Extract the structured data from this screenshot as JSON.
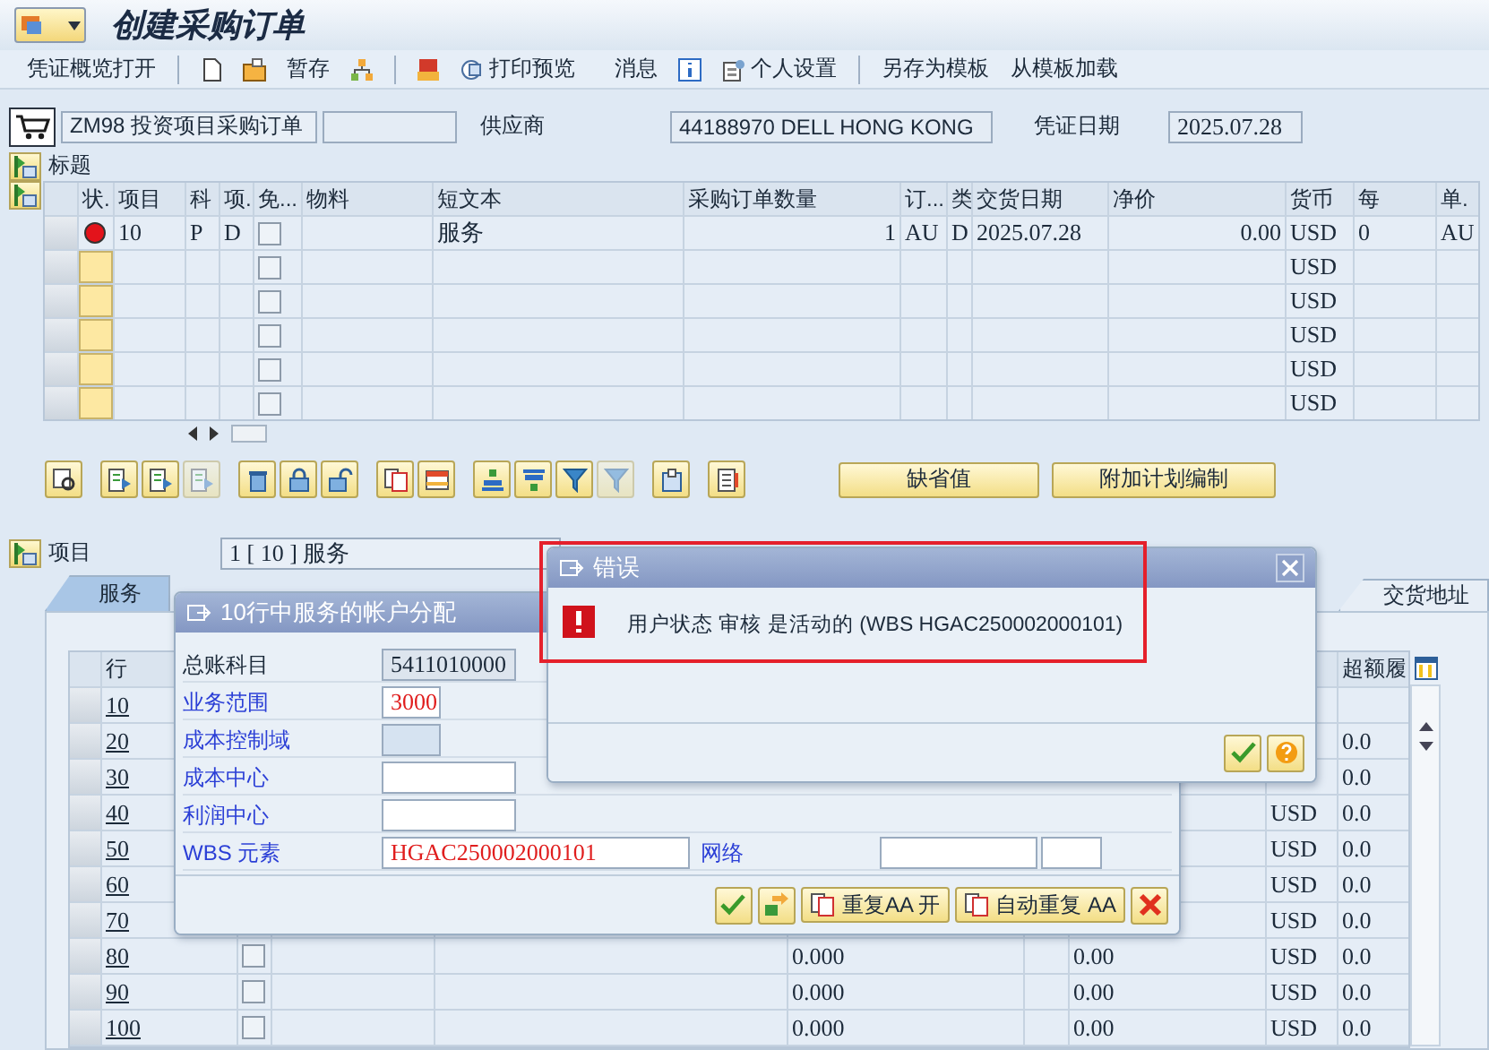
{
  "window": {
    "title": "创建采购订单"
  },
  "toolbar": {
    "overview": "凭证概览打开",
    "hold": "暂存",
    "print_preview": "打印预览",
    "messages": "消息",
    "personal_settings": "个人设置",
    "save_template": "另存为模板",
    "load_template": "从模板加载"
  },
  "header": {
    "doc_type": "ZM98 投资项目采购订单",
    "vendor_label": "供应商",
    "vendor": "44188970 DELL HONG KONG",
    "doc_date_label": "凭证日期",
    "doc_date": "2025.07.28"
  },
  "header_section": {
    "label": "标题"
  },
  "items_table": {
    "columns": [
      "状.",
      "项目",
      "科",
      "项.",
      "免...",
      "物料",
      "短文本",
      "采购订单数量",
      "订...",
      "类",
      "交货日期",
      "净价",
      "货币",
      "每",
      "单."
    ],
    "rows": [
      {
        "error": true,
        "item": "10",
        "acct": "P",
        "cat": "D",
        "free": false,
        "short_text": "服务",
        "qty": "1",
        "unit": "AU",
        "date_cat": "D",
        "delivery_date": "2025.07.28",
        "net_price": "0.00",
        "currency": "USD",
        "per": "0",
        "order_unit": "AU"
      },
      {
        "error": false,
        "free": false,
        "currency": "USD"
      },
      {
        "error": false,
        "free": false,
        "currency": "USD"
      },
      {
        "error": false,
        "free": false,
        "currency": "USD"
      },
      {
        "error": false,
        "free": false,
        "currency": "USD"
      },
      {
        "error": false,
        "free": false,
        "currency": "USD"
      }
    ]
  },
  "table_tools": [
    {
      "disabled": false
    },
    {
      "disabled": false
    },
    {
      "disabled": false
    },
    {
      "disabled": true
    },
    {
      "disabled": false
    },
    {
      "disabled": false
    },
    {
      "disabled": false
    },
    {
      "disabled": false
    },
    {
      "disabled": false
    },
    {
      "disabled": false
    },
    {
      "disabled": false
    },
    {
      "disabled": false
    },
    {
      "disabled": true
    },
    {
      "disabled": false
    },
    {
      "disabled": false
    }
  ],
  "table_buttons": [
    "缺省值",
    "附加计划编制"
  ],
  "item_section": {
    "label": "项目",
    "value": "1 [ 10 ] 服务"
  },
  "tabs": [
    {
      "label": "服务",
      "selected": true
    },
    {
      "label": "交货地址",
      "selected": false
    }
  ],
  "service_table": {
    "columns": [
      "行",
      "超额履"
    ],
    "rows": [
      {
        "line": "10"
      },
      {
        "line": "20",
        "over": "0.0"
      },
      {
        "line": "30",
        "over": "0.0"
      },
      {
        "line": "40",
        "currency": "USD",
        "over": "0.0"
      },
      {
        "line": "50",
        "currency": "USD",
        "over": "0.0"
      },
      {
        "line": "60",
        "currency": "USD",
        "over": "0.0"
      },
      {
        "line": "70",
        "currency": "USD",
        "over": "0.0"
      },
      {
        "line": "80",
        "free": false,
        "quantity": "0.000",
        "price": "0.00",
        "currency": "USD",
        "over": "0.0"
      },
      {
        "line": "90",
        "free": false,
        "quantity": "0.000",
        "price": "0.00",
        "currency": "USD",
        "over": "0.0"
      },
      {
        "line": "100",
        "free": false,
        "quantity": "0.000",
        "price": "0.00",
        "currency": "USD",
        "over": "0.0"
      }
    ]
  },
  "account_dialog": {
    "title": "10行中服务的帐户分配",
    "fields": [
      {
        "label": "总账科目",
        "value": "5411010000",
        "readonly": true,
        "disabled": false,
        "error": false
      },
      {
        "label": "业务范围",
        "value": "3000",
        "readonly": false,
        "disabled": false,
        "error": true
      },
      {
        "label": "成本控制域",
        "readonly": false,
        "disabled": true
      },
      {
        "label": "成本中心",
        "readonly": false,
        "disabled": false
      },
      {
        "label": "利润中心",
        "readonly": false,
        "disabled": false
      },
      {
        "label": "WBS 元素",
        "value": "HGAC250002000101",
        "readonly": false,
        "disabled": false,
        "error": true
      }
    ],
    "network_label": "网络",
    "buttons": [
      "重复AA 开",
      "自动重复 AA"
    ]
  },
  "error_dialog": {
    "title": "错误",
    "message": "用户状态 审核 是活动的 (WBS HGAC250002000101)",
    "highlight": true
  }
}
